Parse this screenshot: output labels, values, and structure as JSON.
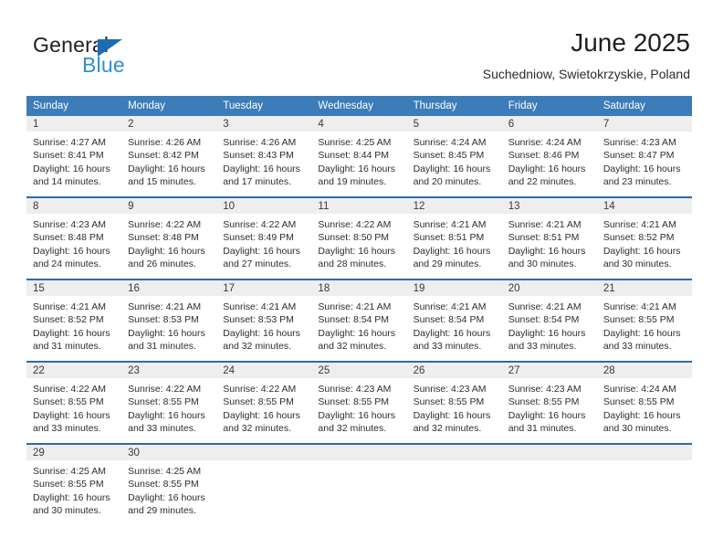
{
  "brand": {
    "name_part1": "General",
    "name_part2": "Blue",
    "triangle_color": "#1a6cb5",
    "blue_color": "#2e8fd6"
  },
  "header": {
    "title": "June 2025",
    "subtitle": "Suchedniow, Swietokrzyskie, Poland"
  },
  "theme": {
    "header_bg": "#3b7cb9",
    "daynum_bg": "#efeeee",
    "separator": "#2b6ca8"
  },
  "weekdays": [
    "Sunday",
    "Monday",
    "Tuesday",
    "Wednesday",
    "Thursday",
    "Friday",
    "Saturday"
  ],
  "weeks": [
    [
      {
        "day": "1",
        "sunrise": "Sunrise: 4:27 AM",
        "sunset": "Sunset: 8:41 PM",
        "daylight1": "Daylight: 16 hours",
        "daylight2": "and 14 minutes."
      },
      {
        "day": "2",
        "sunrise": "Sunrise: 4:26 AM",
        "sunset": "Sunset: 8:42 PM",
        "daylight1": "Daylight: 16 hours",
        "daylight2": "and 15 minutes."
      },
      {
        "day": "3",
        "sunrise": "Sunrise: 4:26 AM",
        "sunset": "Sunset: 8:43 PM",
        "daylight1": "Daylight: 16 hours",
        "daylight2": "and 17 minutes."
      },
      {
        "day": "4",
        "sunrise": "Sunrise: 4:25 AM",
        "sunset": "Sunset: 8:44 PM",
        "daylight1": "Daylight: 16 hours",
        "daylight2": "and 19 minutes."
      },
      {
        "day": "5",
        "sunrise": "Sunrise: 4:24 AM",
        "sunset": "Sunset: 8:45 PM",
        "daylight1": "Daylight: 16 hours",
        "daylight2": "and 20 minutes."
      },
      {
        "day": "6",
        "sunrise": "Sunrise: 4:24 AM",
        "sunset": "Sunset: 8:46 PM",
        "daylight1": "Daylight: 16 hours",
        "daylight2": "and 22 minutes."
      },
      {
        "day": "7",
        "sunrise": "Sunrise: 4:23 AM",
        "sunset": "Sunset: 8:47 PM",
        "daylight1": "Daylight: 16 hours",
        "daylight2": "and 23 minutes."
      }
    ],
    [
      {
        "day": "8",
        "sunrise": "Sunrise: 4:23 AM",
        "sunset": "Sunset: 8:48 PM",
        "daylight1": "Daylight: 16 hours",
        "daylight2": "and 24 minutes."
      },
      {
        "day": "9",
        "sunrise": "Sunrise: 4:22 AM",
        "sunset": "Sunset: 8:48 PM",
        "daylight1": "Daylight: 16 hours",
        "daylight2": "and 26 minutes."
      },
      {
        "day": "10",
        "sunrise": "Sunrise: 4:22 AM",
        "sunset": "Sunset: 8:49 PM",
        "daylight1": "Daylight: 16 hours",
        "daylight2": "and 27 minutes."
      },
      {
        "day": "11",
        "sunrise": "Sunrise: 4:22 AM",
        "sunset": "Sunset: 8:50 PM",
        "daylight1": "Daylight: 16 hours",
        "daylight2": "and 28 minutes."
      },
      {
        "day": "12",
        "sunrise": "Sunrise: 4:21 AM",
        "sunset": "Sunset: 8:51 PM",
        "daylight1": "Daylight: 16 hours",
        "daylight2": "and 29 minutes."
      },
      {
        "day": "13",
        "sunrise": "Sunrise: 4:21 AM",
        "sunset": "Sunset: 8:51 PM",
        "daylight1": "Daylight: 16 hours",
        "daylight2": "and 30 minutes."
      },
      {
        "day": "14",
        "sunrise": "Sunrise: 4:21 AM",
        "sunset": "Sunset: 8:52 PM",
        "daylight1": "Daylight: 16 hours",
        "daylight2": "and 30 minutes."
      }
    ],
    [
      {
        "day": "15",
        "sunrise": "Sunrise: 4:21 AM",
        "sunset": "Sunset: 8:52 PM",
        "daylight1": "Daylight: 16 hours",
        "daylight2": "and 31 minutes."
      },
      {
        "day": "16",
        "sunrise": "Sunrise: 4:21 AM",
        "sunset": "Sunset: 8:53 PM",
        "daylight1": "Daylight: 16 hours",
        "daylight2": "and 31 minutes."
      },
      {
        "day": "17",
        "sunrise": "Sunrise: 4:21 AM",
        "sunset": "Sunset: 8:53 PM",
        "daylight1": "Daylight: 16 hours",
        "daylight2": "and 32 minutes."
      },
      {
        "day": "18",
        "sunrise": "Sunrise: 4:21 AM",
        "sunset": "Sunset: 8:54 PM",
        "daylight1": "Daylight: 16 hours",
        "daylight2": "and 32 minutes."
      },
      {
        "day": "19",
        "sunrise": "Sunrise: 4:21 AM",
        "sunset": "Sunset: 8:54 PM",
        "daylight1": "Daylight: 16 hours",
        "daylight2": "and 33 minutes."
      },
      {
        "day": "20",
        "sunrise": "Sunrise: 4:21 AM",
        "sunset": "Sunset: 8:54 PM",
        "daylight1": "Daylight: 16 hours",
        "daylight2": "and 33 minutes."
      },
      {
        "day": "21",
        "sunrise": "Sunrise: 4:21 AM",
        "sunset": "Sunset: 8:55 PM",
        "daylight1": "Daylight: 16 hours",
        "daylight2": "and 33 minutes."
      }
    ],
    [
      {
        "day": "22",
        "sunrise": "Sunrise: 4:22 AM",
        "sunset": "Sunset: 8:55 PM",
        "daylight1": "Daylight: 16 hours",
        "daylight2": "and 33 minutes."
      },
      {
        "day": "23",
        "sunrise": "Sunrise: 4:22 AM",
        "sunset": "Sunset: 8:55 PM",
        "daylight1": "Daylight: 16 hours",
        "daylight2": "and 33 minutes."
      },
      {
        "day": "24",
        "sunrise": "Sunrise: 4:22 AM",
        "sunset": "Sunset: 8:55 PM",
        "daylight1": "Daylight: 16 hours",
        "daylight2": "and 32 minutes."
      },
      {
        "day": "25",
        "sunrise": "Sunrise: 4:23 AM",
        "sunset": "Sunset: 8:55 PM",
        "daylight1": "Daylight: 16 hours",
        "daylight2": "and 32 minutes."
      },
      {
        "day": "26",
        "sunrise": "Sunrise: 4:23 AM",
        "sunset": "Sunset: 8:55 PM",
        "daylight1": "Daylight: 16 hours",
        "daylight2": "and 32 minutes."
      },
      {
        "day": "27",
        "sunrise": "Sunrise: 4:23 AM",
        "sunset": "Sunset: 8:55 PM",
        "daylight1": "Daylight: 16 hours",
        "daylight2": "and 31 minutes."
      },
      {
        "day": "28",
        "sunrise": "Sunrise: 4:24 AM",
        "sunset": "Sunset: 8:55 PM",
        "daylight1": "Daylight: 16 hours",
        "daylight2": "and 30 minutes."
      }
    ],
    [
      {
        "day": "29",
        "sunrise": "Sunrise: 4:25 AM",
        "sunset": "Sunset: 8:55 PM",
        "daylight1": "Daylight: 16 hours",
        "daylight2": "and 30 minutes."
      },
      {
        "day": "30",
        "sunrise": "Sunrise: 4:25 AM",
        "sunset": "Sunset: 8:55 PM",
        "daylight1": "Daylight: 16 hours",
        "daylight2": "and 29 minutes."
      },
      {
        "day": "",
        "sunrise": "",
        "sunset": "",
        "daylight1": "",
        "daylight2": ""
      },
      {
        "day": "",
        "sunrise": "",
        "sunset": "",
        "daylight1": "",
        "daylight2": ""
      },
      {
        "day": "",
        "sunrise": "",
        "sunset": "",
        "daylight1": "",
        "daylight2": ""
      },
      {
        "day": "",
        "sunrise": "",
        "sunset": "",
        "daylight1": "",
        "daylight2": ""
      },
      {
        "day": "",
        "sunrise": "",
        "sunset": "",
        "daylight1": "",
        "daylight2": ""
      }
    ]
  ]
}
